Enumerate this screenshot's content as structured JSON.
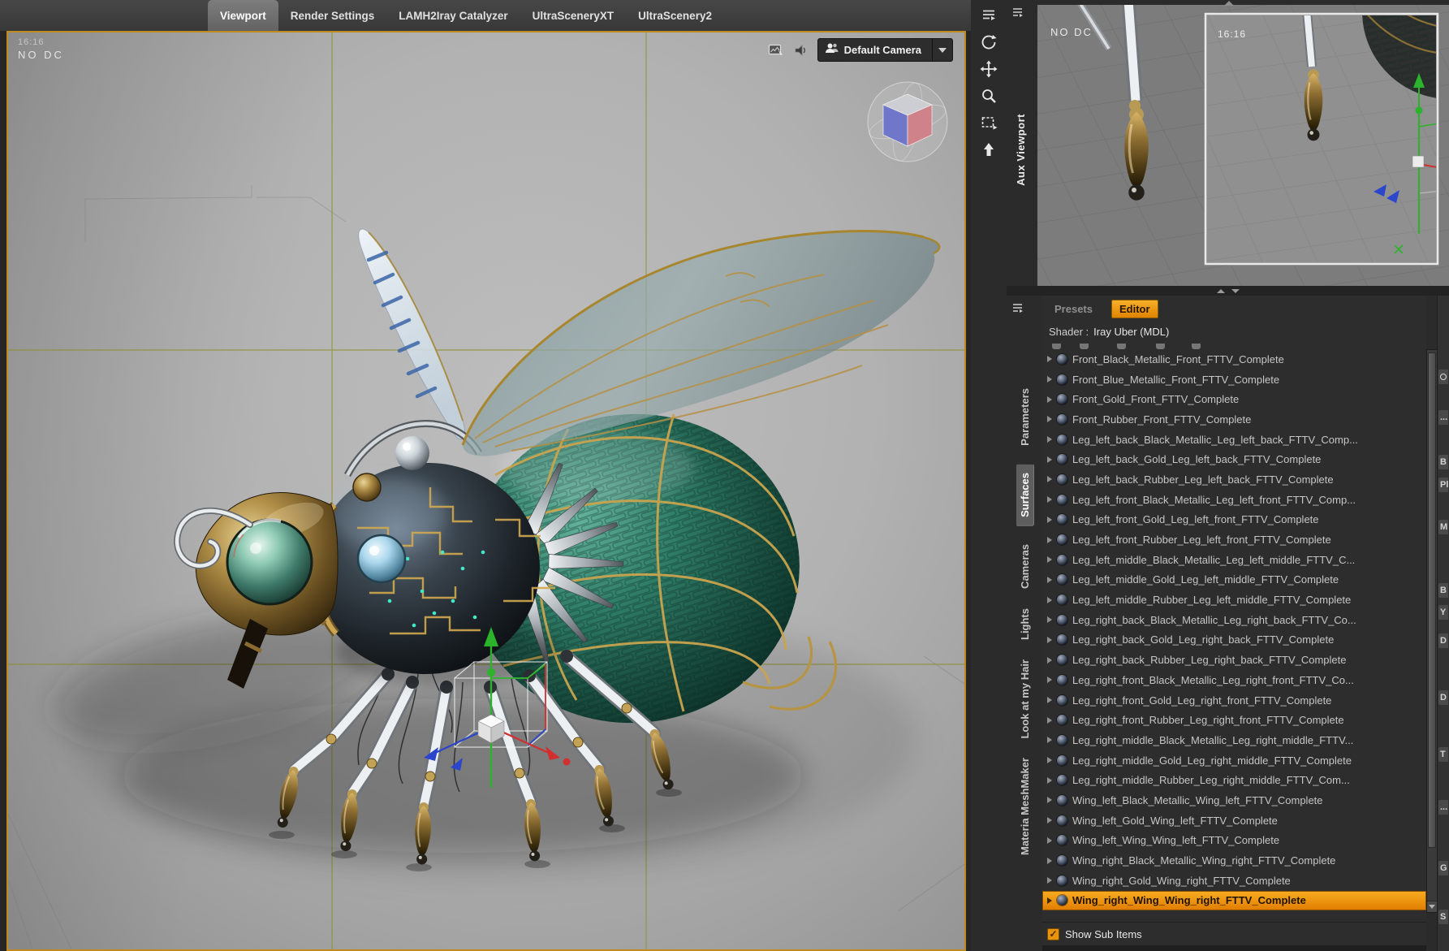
{
  "main_tabs": [
    {
      "label": "Viewport",
      "selected": true
    },
    {
      "label": "Render Settings",
      "selected": false
    },
    {
      "label": "LAMH2Iray Catalyzer",
      "selected": false
    },
    {
      "label": "UltraSceneryXT",
      "selected": false
    },
    {
      "label": "UltraScenery2",
      "selected": false
    }
  ],
  "viewport": {
    "hud_line1": "16:16",
    "hud_line2": "NO DC",
    "camera_selector": {
      "value": "Default Camera"
    }
  },
  "aux_viewport": {
    "tab_label": "Aux Viewport",
    "hud": "NO DC",
    "inner_hud": "16:16"
  },
  "side_tabs": [
    {
      "label": "Parameters",
      "selected": false
    },
    {
      "label": "Surfaces",
      "selected": true
    },
    {
      "label": "Cameras",
      "selected": false
    },
    {
      "label": "Lights",
      "selected": false
    },
    {
      "label": "Look at my Hair",
      "selected": false
    },
    {
      "label": "Materia MeshMaker",
      "selected": false
    }
  ],
  "surfaces_panel": {
    "tabs": [
      {
        "label": "Presets",
        "selected": false
      },
      {
        "label": "Editor",
        "selected": true
      }
    ],
    "shader_label": "Shader :",
    "shader_value": "Iray Uber (MDL)",
    "items": [
      {
        "label": "Front_Black_Metallic_Front_FTTV_Complete",
        "selected": false
      },
      {
        "label": "Front_Blue_Metallic_Front_FTTV_Complete",
        "selected": false
      },
      {
        "label": "Front_Gold_Front_FTTV_Complete",
        "selected": false
      },
      {
        "label": "Front_Rubber_Front_FTTV_Complete",
        "selected": false
      },
      {
        "label": "Leg_left_back_Black_Metallic_Leg_left_back_FTTV_Comp...",
        "selected": false
      },
      {
        "label": "Leg_left_back_Gold_Leg_left_back_FTTV_Complete",
        "selected": false
      },
      {
        "label": "Leg_left_back_Rubber_Leg_left_back_FTTV_Complete",
        "selected": false
      },
      {
        "label": "Leg_left_front_Black_Metallic_Leg_left_front_FTTV_Comp...",
        "selected": false
      },
      {
        "label": "Leg_left_front_Gold_Leg_left_front_FTTV_Complete",
        "selected": false
      },
      {
        "label": "Leg_left_front_Rubber_Leg_left_front_FTTV_Complete",
        "selected": false
      },
      {
        "label": "Leg_left_middle_Black_Metallic_Leg_left_middle_FTTV_C...",
        "selected": false
      },
      {
        "label": "Leg_left_middle_Gold_Leg_left_middle_FTTV_Complete",
        "selected": false
      },
      {
        "label": "Leg_left_middle_Rubber_Leg_left_middle_FTTV_Complete",
        "selected": false
      },
      {
        "label": "Leg_right_back_Black_Metallic_Leg_right_back_FTTV_Co...",
        "selected": false
      },
      {
        "label": "Leg_right_back_Gold_Leg_right_back_FTTV_Complete",
        "selected": false
      },
      {
        "label": "Leg_right_back_Rubber_Leg_right_back_FTTV_Complete",
        "selected": false
      },
      {
        "label": "Leg_right_front_Black_Metallic_Leg_right_front_FTTV_Co...",
        "selected": false
      },
      {
        "label": "Leg_right_front_Gold_Leg_right_front_FTTV_Complete",
        "selected": false
      },
      {
        "label": "Leg_right_front_Rubber_Leg_right_front_FTTV_Complete",
        "selected": false
      },
      {
        "label": "Leg_right_middle_Black_Metallic_Leg_right_middle_FTTV...",
        "selected": false
      },
      {
        "label": "Leg_right_middle_Gold_Leg_right_middle_FTTV_Complete",
        "selected": false
      },
      {
        "label": "Leg_right_middle_Rubber_Leg_right_middle_FTTV_Com...",
        "selected": false
      },
      {
        "label": "Wing_left_Black_Metallic_Wing_left_FTTV_Complete",
        "selected": false
      },
      {
        "label": "Wing_left_Gold_Wing_left_FTTV_Complete",
        "selected": false
      },
      {
        "label": "Wing_left_Wing_Wing_left_FTTV_Complete",
        "selected": false
      },
      {
        "label": "Wing_right_Black_Metallic_Wing_right_FTTV_Complete",
        "selected": false
      },
      {
        "label": "Wing_right_Gold_Wing_right_FTTV_Complete",
        "selected": false
      },
      {
        "label": "Wing_right_Wing_Wing_right_FTTV_Complete",
        "selected": true
      }
    ],
    "footer": {
      "show_sub_items_label": "Show Sub Items",
      "checked": true
    }
  },
  "right_edge_fragments": [
    {
      "icon": "search-icon"
    },
    {
      "text": "..."
    },
    {
      "text": "B"
    },
    {
      "text": "Pl"
    },
    {
      "text": "M"
    },
    {
      "text": "B"
    },
    {
      "text": "Y"
    },
    {
      "text": "D"
    },
    {
      "text": "D"
    },
    {
      "text": "T"
    },
    {
      "text": "..."
    },
    {
      "text": "G"
    },
    {
      "text": "S"
    }
  ],
  "colors": {
    "accent_orange": "#e8930c",
    "selection_top": "#f9ad22",
    "selection_bottom": "#e07c00",
    "viewport_frame": "#c08a1e"
  }
}
